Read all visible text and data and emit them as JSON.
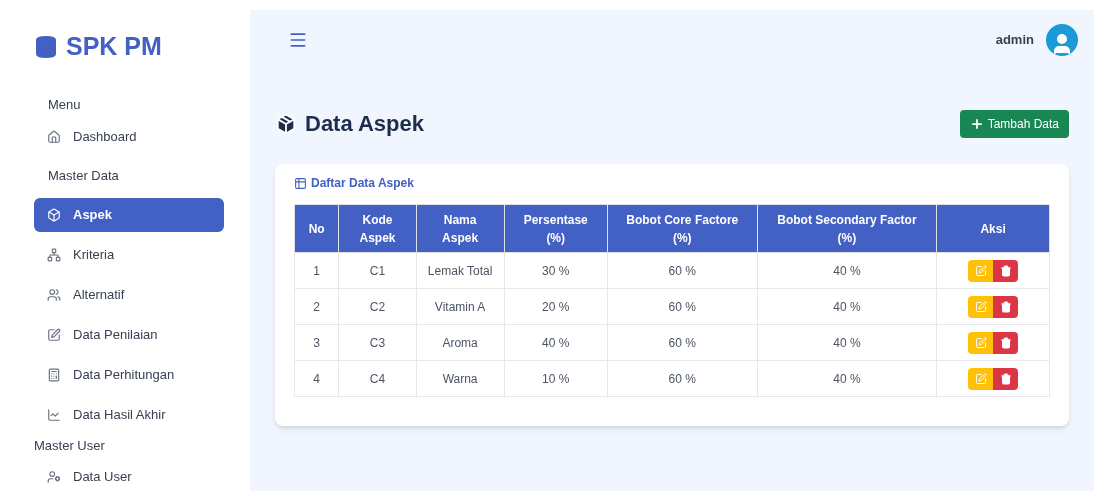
{
  "brand": "SPK PM",
  "sidebar": [
    {
      "kind": "heading",
      "label": "Menu"
    },
    {
      "kind": "item",
      "label": "Dashboard",
      "selected": false
    },
    {
      "kind": "heading",
      "label": "Master Data"
    },
    {
      "kind": "item",
      "label": "Aspek",
      "selected": true
    },
    {
      "kind": "item",
      "label": "Kriteria",
      "selected": false
    },
    {
      "kind": "item",
      "label": "Alternatif",
      "selected": false
    },
    {
      "kind": "item",
      "label": "Data Penilaian",
      "selected": false
    },
    {
      "kind": "item",
      "label": "Data Perhitungan",
      "selected": false
    },
    {
      "kind": "item",
      "label": "Data Hasil Akhir",
      "selected": false
    },
    {
      "kind": "heading",
      "label": "Master User"
    },
    {
      "kind": "item",
      "label": "Data User",
      "selected": false
    }
  ],
  "topbar": {
    "user": "admin"
  },
  "page_title": "Data Aspek",
  "add_button": "Tambah Data",
  "card_title": "Daftar Data Aspek",
  "table": {
    "columns": [
      "No",
      "Kode\nAspek",
      "Nama\nAspek",
      "Persentase\n(%)",
      "Bobot Core Factore\n(%)",
      "Bobot Secondary Factor\n(%)",
      "Aksi"
    ],
    "rows": [
      [
        "1",
        "C1",
        "Lemak Total",
        "30 %",
        "60 %",
        "40 %"
      ],
      [
        "2",
        "C2",
        "Vitamin A",
        "20 %",
        "60 %",
        "40 %"
      ],
      [
        "3",
        "C3",
        "Aroma",
        "40 %",
        "60 %",
        "40 %"
      ],
      [
        "4",
        "C4",
        "Warna",
        "10 %",
        "60 %",
        "40 %"
      ]
    ]
  }
}
